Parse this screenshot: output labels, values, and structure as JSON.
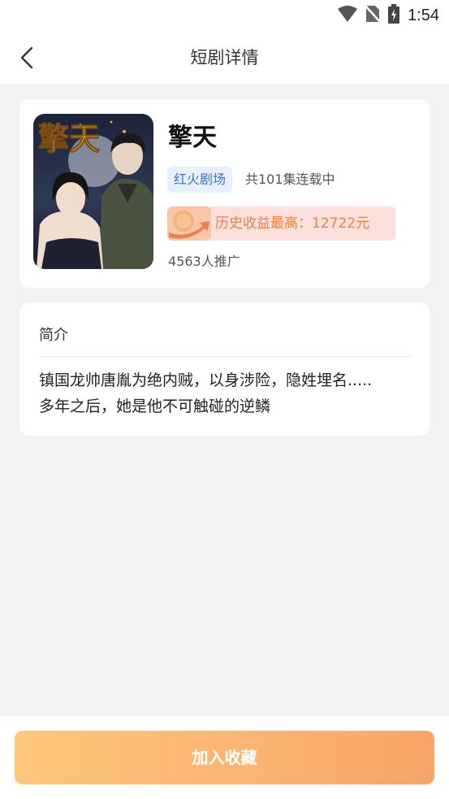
{
  "status_bar": {
    "time": "1:54",
    "icons": [
      "wifi-icon",
      "no-sim-icon",
      "battery-charging-icon"
    ]
  },
  "header": {
    "title": "短剧详情",
    "back_icon": "chevron-left-icon"
  },
  "drama": {
    "title": "擎天",
    "poster_title": "擎天",
    "tag": "红火剧场",
    "episodes": "共101集连载中",
    "earnings": "历史收益最高：12722元",
    "earnings_icon": "coin-arrow-icon",
    "promoters": "4563人推广"
  },
  "intro": {
    "heading": "简介",
    "lines": [
      "镇国龙帅唐胤为绝内贼，以身涉险，隐姓埋名.....",
      "多年之后，她是他不可触碰的逆鳞"
    ]
  },
  "actions": {
    "favorite_label": "加入收藏"
  },
  "colors": {
    "background": "#f2f3f5",
    "tag_text": "#3b74d8",
    "tag_bg": "#e9f0fd",
    "earnings_text": "#ec8244",
    "earnings_bg": "#fde0dc",
    "button_gradient_start": "#fdc77a",
    "button_gradient_end": "#f9a56a"
  }
}
